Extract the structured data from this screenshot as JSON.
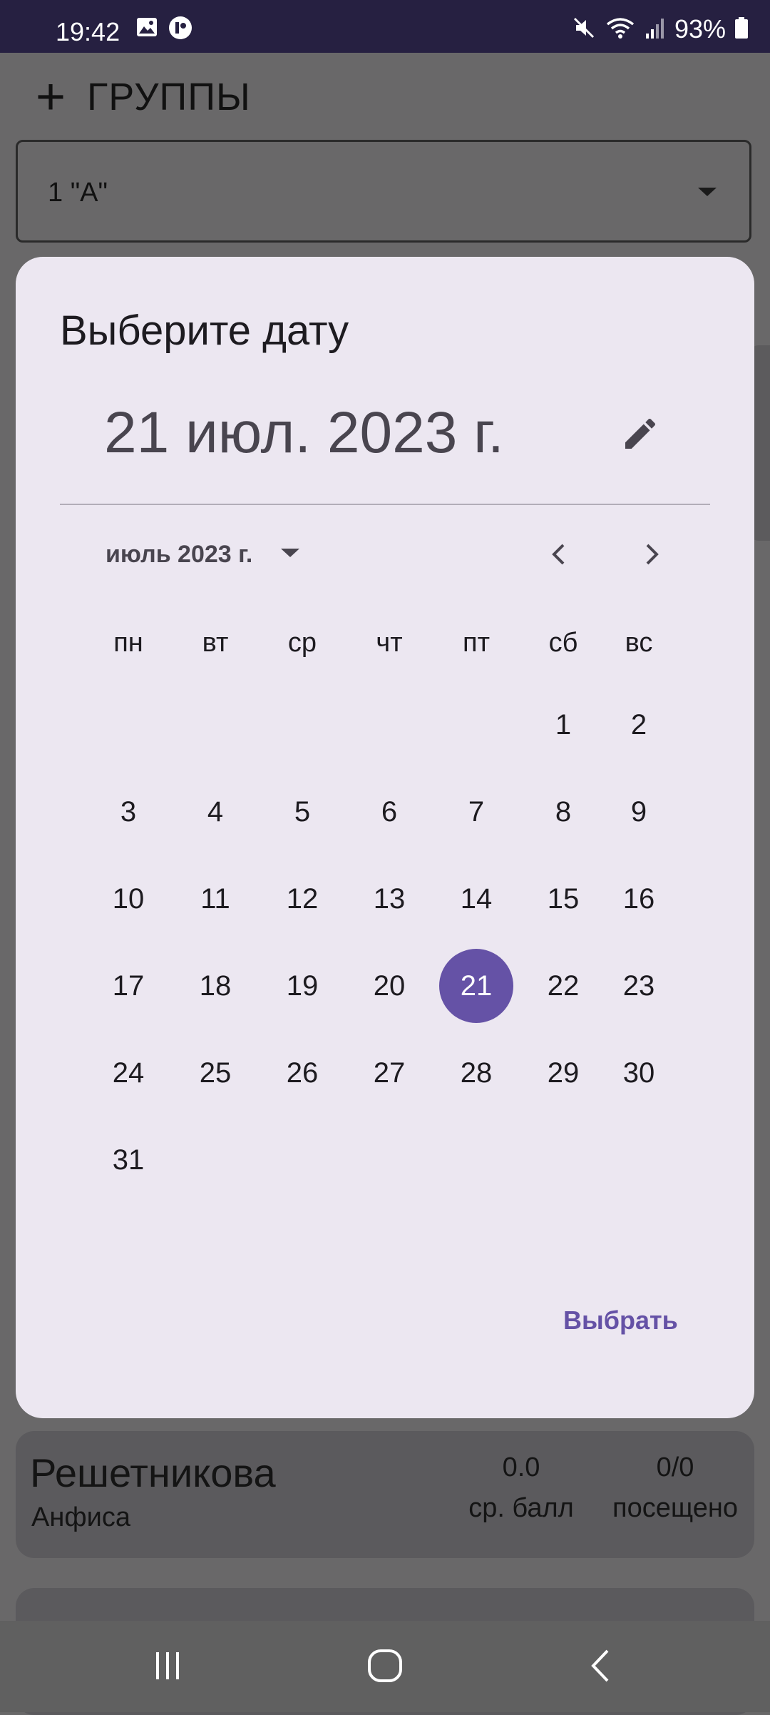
{
  "status_bar": {
    "time": "19:42",
    "battery": "93%",
    "icons": [
      "image-icon",
      "app-icon",
      "mute-icon",
      "wifi-icon",
      "signal-icon",
      "battery-icon"
    ]
  },
  "background": {
    "header_title": "ГРУППЫ",
    "add_icon": "plus-icon",
    "group_select": {
      "value": "1 \"А\""
    },
    "students": [
      {
        "last_name": "Решетникова",
        "first_name": "Анфиса",
        "avg": "0.0",
        "avg_label": "ср. балл",
        "visited": "0/0",
        "visited_label": "посещено"
      }
    ]
  },
  "date_picker": {
    "headline": "Выберите дату",
    "selected_date": "21 июл. 2023 г.",
    "month_label": "июль 2023 г.",
    "weekdays": [
      "пн",
      "вт",
      "ср",
      "чт",
      "пт",
      "сб",
      "вс"
    ],
    "weeks": [
      [
        "",
        "",
        "",
        "",
        "",
        "1",
        "2"
      ],
      [
        "3",
        "4",
        "5",
        "6",
        "7",
        "8",
        "9"
      ],
      [
        "10",
        "11",
        "12",
        "13",
        "14",
        "15",
        "16"
      ],
      [
        "17",
        "18",
        "19",
        "20",
        "21",
        "22",
        "23"
      ],
      [
        "24",
        "25",
        "26",
        "27",
        "28",
        "29",
        "30"
      ],
      [
        "31",
        "",
        "",
        "",
        "",
        "",
        ""
      ]
    ],
    "selected_day": "21",
    "confirm_label": "Выбрать",
    "accent_color": "#6552a6"
  },
  "nav_bar": {
    "buttons": [
      "recents-icon",
      "home-icon",
      "back-icon"
    ]
  }
}
